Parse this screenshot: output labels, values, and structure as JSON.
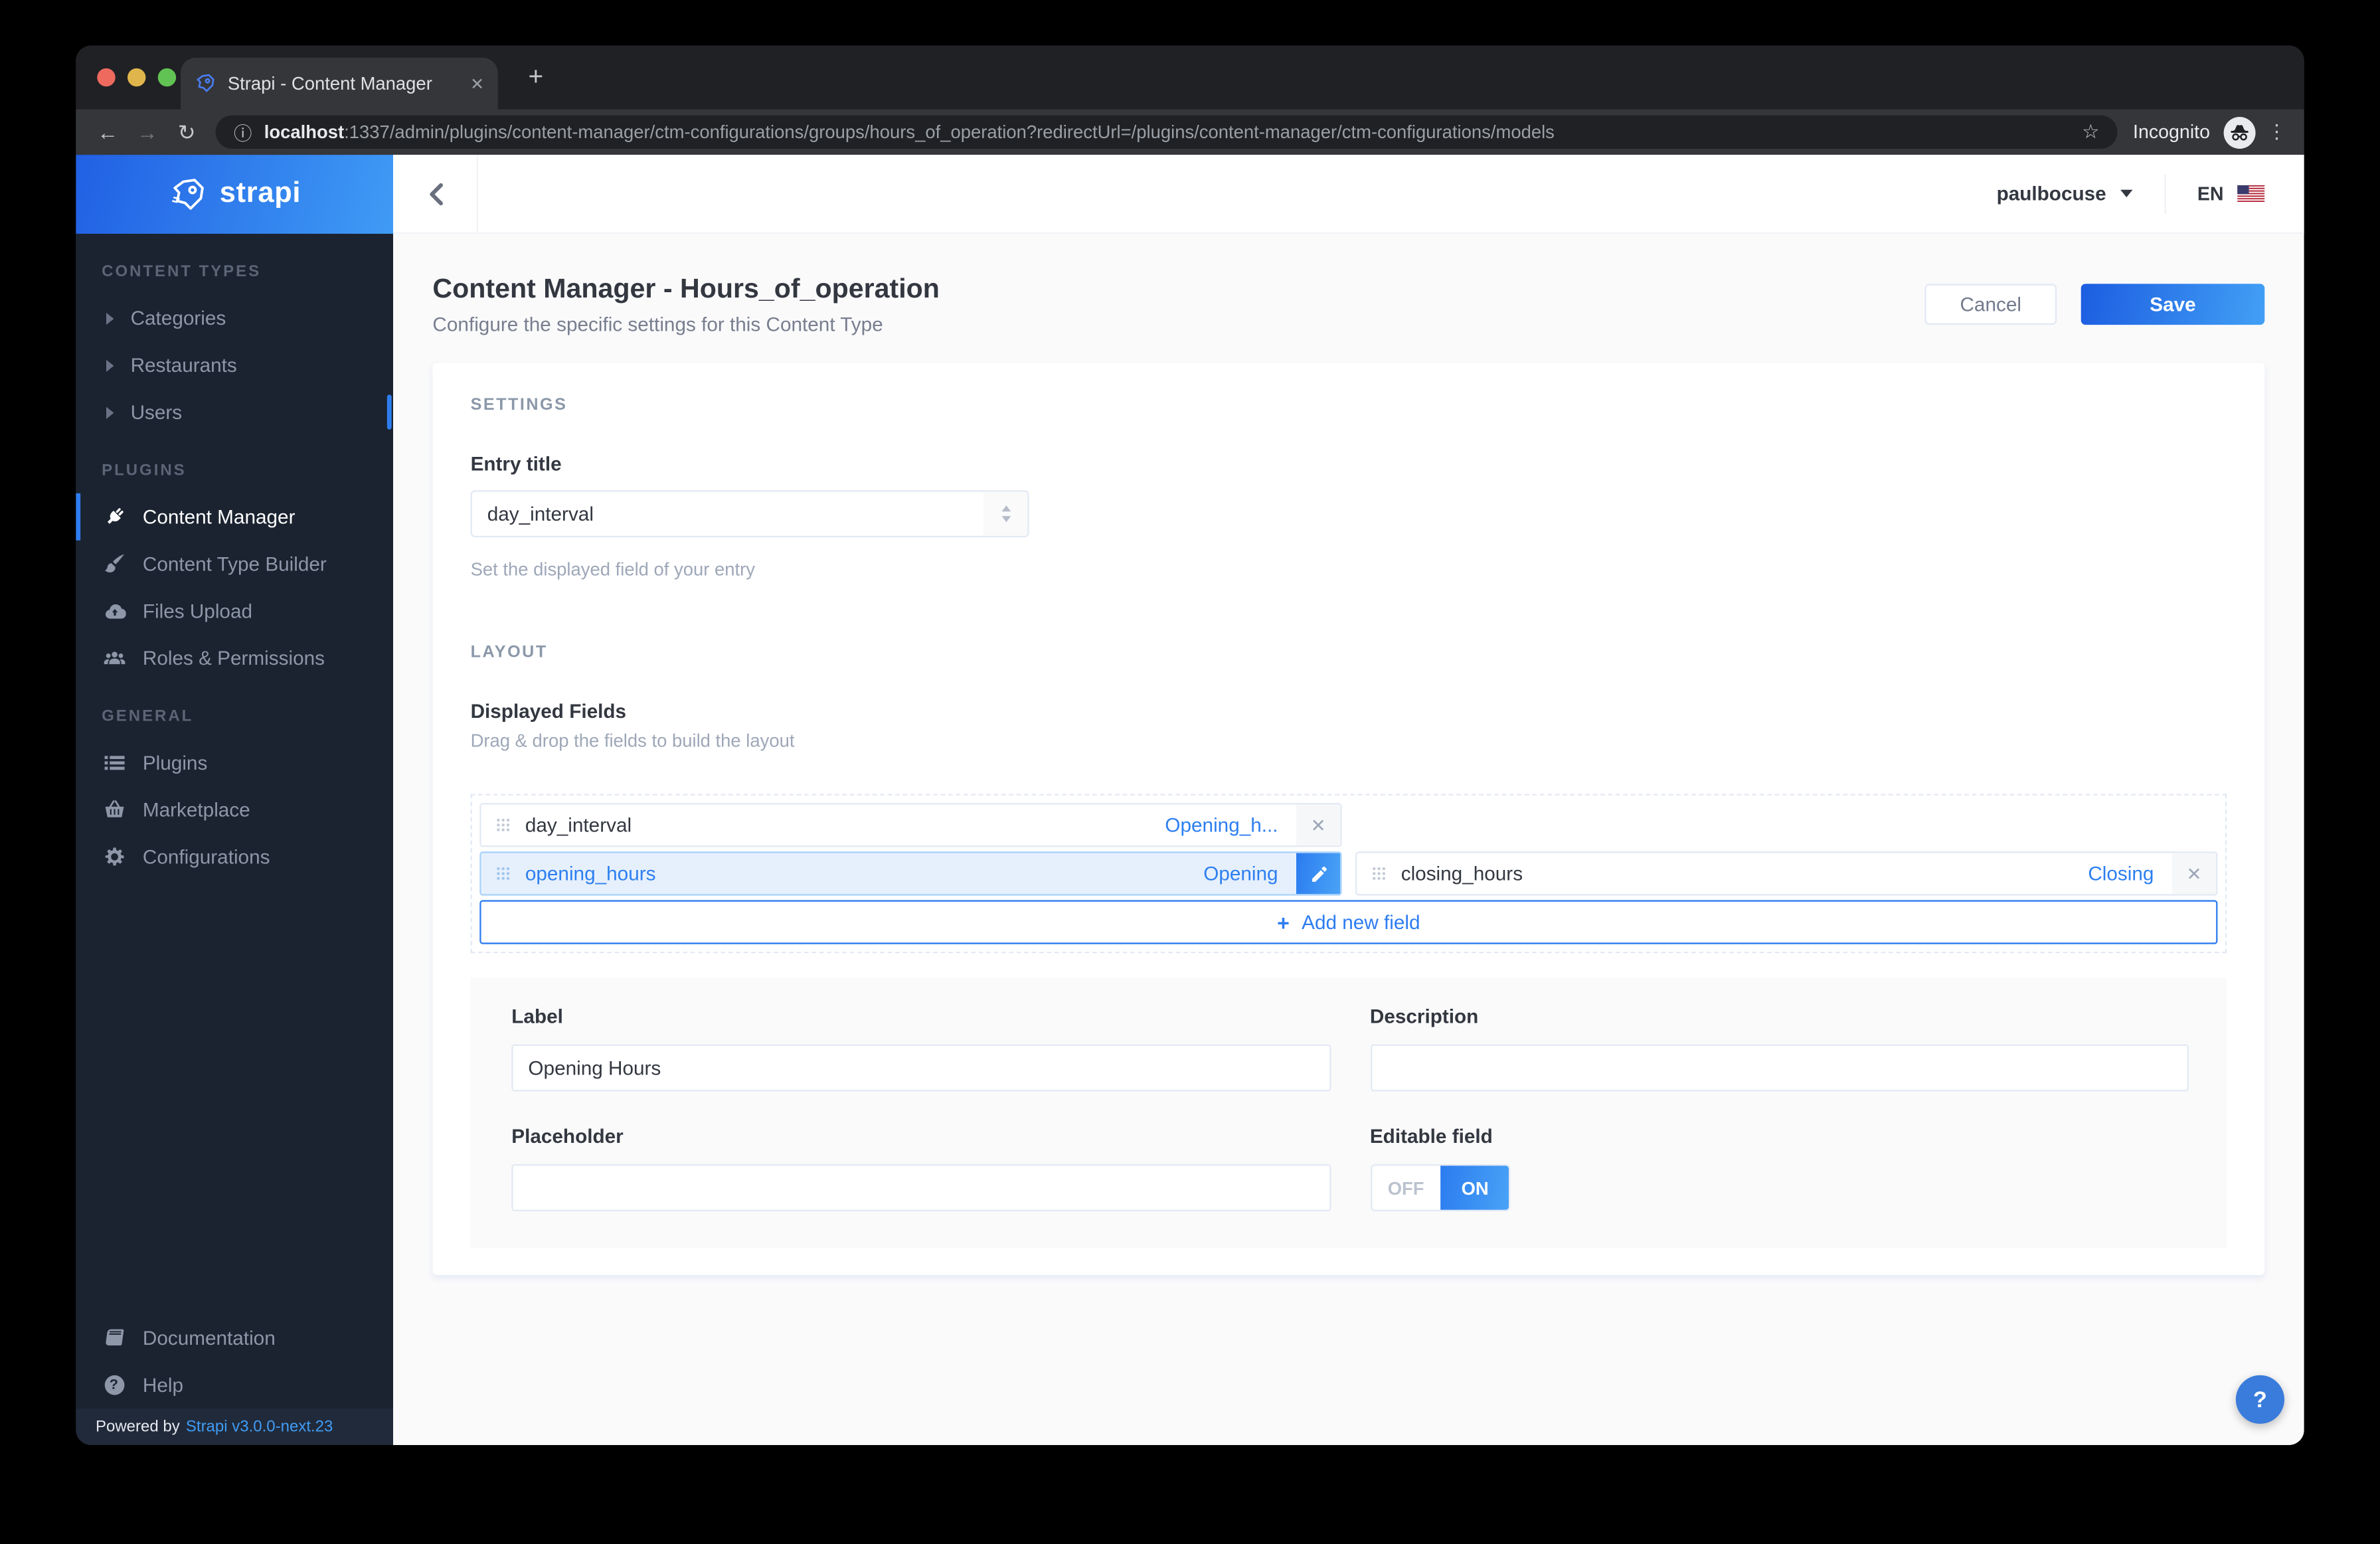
{
  "browser": {
    "tab": {
      "title": "Strapi - Content Manager"
    },
    "address": {
      "host": "localhost",
      "rest": ":1337/admin/plugins/content-manager/ctm-configurations/groups/hours_of_operation?redirectUrl=/plugins/content-manager/ctm-configurations/models",
      "incognito_label": "Incognito"
    },
    "icons": {
      "close": "✕",
      "new_tab": "+",
      "back": "←",
      "forward": "→",
      "reload": "↻",
      "info": "ⓘ",
      "star": "☆",
      "menu": "⋮"
    }
  },
  "sidebar": {
    "brand": "strapi",
    "sections": [
      {
        "title": "CONTENT TYPES",
        "items": [
          {
            "label": "Categories"
          },
          {
            "label": "Restaurants"
          },
          {
            "label": "Users"
          }
        ]
      },
      {
        "title": "PLUGINS",
        "items": [
          {
            "label": "Content Manager"
          },
          {
            "label": "Content Type Builder"
          },
          {
            "label": "Files Upload"
          },
          {
            "label": "Roles & Permissions"
          }
        ]
      },
      {
        "title": "GENERAL",
        "items": [
          {
            "label": "Plugins"
          },
          {
            "label": "Marketplace"
          },
          {
            "label": "Configurations"
          }
        ]
      }
    ],
    "footer_links": [
      {
        "label": "Documentation"
      },
      {
        "label": "Help"
      }
    ],
    "powered_by": {
      "prefix": "Powered by",
      "link": "Strapi v3.0.0-next.23"
    },
    "help_icon_glyph": "?"
  },
  "header": {
    "username": "paulbocuse",
    "language": "EN"
  },
  "page": {
    "title": "Content Manager - Hours_of_operation",
    "subtitle": "Configure the specific settings for this Content Type",
    "cancel_label": "Cancel",
    "save_label": "Save"
  },
  "settings": {
    "section_title": "SETTINGS",
    "entry_title_label": "Entry title",
    "entry_title_value": "day_interval",
    "entry_title_help": "Set the displayed field of your entry"
  },
  "layout_section": {
    "section_title": "LAYOUT",
    "fields_title": "Displayed Fields",
    "fields_help": "Drag & drop the fields to build the layout",
    "rows": [
      {
        "fields": [
          {
            "name": "day_interval",
            "tag": "Opening_h...",
            "close": "✕"
          }
        ]
      },
      {
        "fields": [
          {
            "name": "opening_hours",
            "tag": "Opening"
          },
          {
            "name": "closing_hours",
            "tag": "Closing",
            "close": "✕"
          }
        ]
      }
    ],
    "add_field_plus": "+",
    "add_field_label": "Add new field"
  },
  "field_form": {
    "label_label": "Label",
    "label_value": "Opening Hours",
    "description_label": "Description",
    "description_value": "",
    "placeholder_label": "Placeholder",
    "placeholder_value": "",
    "editable_label": "Editable field",
    "toggle_off": "OFF",
    "toggle_on": "ON"
  },
  "help_fab_glyph": "?",
  "colors": {
    "accent_blue": "#007eff",
    "link_blue": "#2d7ff0",
    "sidebar_bg": "#1b2330",
    "brand_gradient": [
      "#2160e4",
      "#3f9bf5"
    ],
    "save_gradient": [
      "#1c5de1",
      "#42a0f5"
    ],
    "selected_field_bg": "#e6f0fc",
    "selected_field_border": "#a9d2fb",
    "border_gray": "#e3e9f3",
    "text_dark": "#333740",
    "text_gray": "#787e8f"
  }
}
